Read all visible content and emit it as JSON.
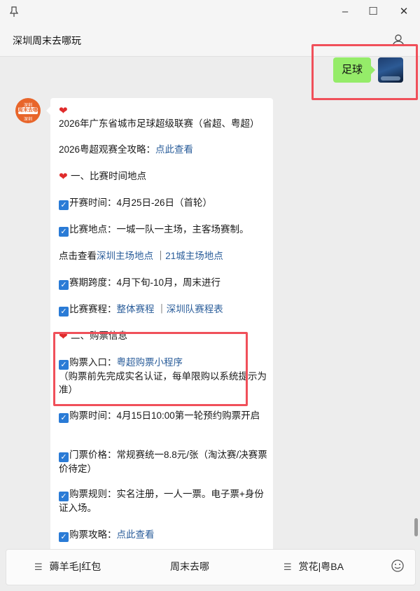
{
  "window": {
    "title": "深圳周末去哪玩",
    "pin_icon": "pin-icon",
    "minimize_glyph": "–",
    "maximize_glyph": "☐",
    "close_glyph": "✕"
  },
  "chat": {
    "sent_message": "足球",
    "bot_avatar": {
      "line1": "深圳",
      "line2": "周末去哪",
      "line3": "深圳"
    },
    "bot_message": {
      "title": "2026年广东省城市足球超级联赛（省超、粤超）",
      "guide_prefix": "2026粤超观赛全攻略：",
      "guide_link": "点此查看",
      "section1": "一、比赛时间地点",
      "time_label": "开赛时间：",
      "time_value": "4月25日-26日（首轮）",
      "venue_label": "比赛地点：",
      "venue_value": "一城一队一主场，主客场赛制。",
      "venue_more_prefix": "点击查看",
      "venue_link1": "深圳主场地点",
      "venue_sep": "｜",
      "venue_link2": "21城主场地点",
      "span_label": "赛期跨度：",
      "span_value": "4月下旬-10月，周末进行",
      "schedule_label": "比赛赛程：",
      "schedule_link1": "整体赛程",
      "schedule_sep": "｜",
      "schedule_link2": "深圳队赛程表",
      "section2": "二、购票信息",
      "ticket_entry_label": "购票入口：",
      "ticket_entry_link": "粤超购票小程序",
      "ticket_entry_note": "（购票前先完成实名认证，每单限购以系统提示为准）",
      "ticket_time_label": "购票时间：",
      "ticket_time_value": "4月15日10:00第一轮预约购票开启",
      "price_label": "门票价格：",
      "price_value": "常规赛统一8.8元/张（淘汰赛/决赛票价待定）",
      "rule_label": "购票规则：",
      "rule_value": "实名注册，一人一票。电子票+身份证入场。",
      "strategy_label": "购票攻略：",
      "strategy_link": "点此查看"
    }
  },
  "bottom_menu": {
    "items": [
      {
        "label": "薅羊毛|红包",
        "icon": "menu-icon"
      },
      {
        "label": "周末去哪"
      },
      {
        "label": "赏花|粤BA",
        "icon": "menu-icon"
      }
    ],
    "emoji_icon": "emoji-icon"
  },
  "colors": {
    "sent_bubble": "#95ec69",
    "link": "#2a5d9a",
    "checkbox": "#2a7bd6",
    "heart": "#e02b2b",
    "highlight_box": "#f0505a",
    "avatar_orange": "#e8652a"
  }
}
